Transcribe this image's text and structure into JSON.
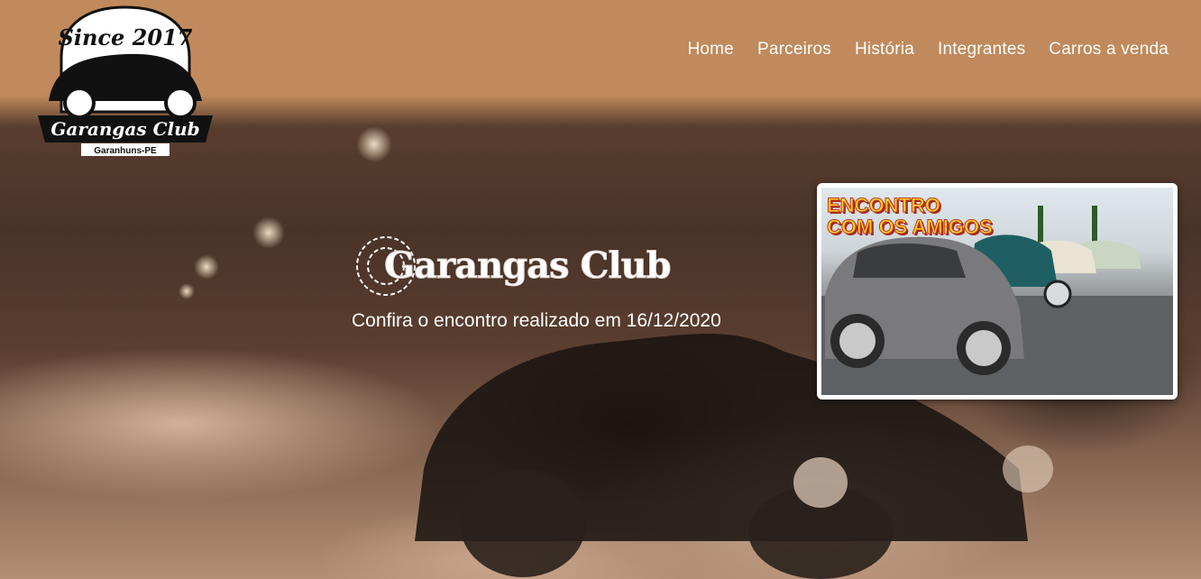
{
  "header": {
    "logo": {
      "top_text": "Since 2017",
      "banner_text": "Garangas Club",
      "bottom_text": "Garanhuns-PE"
    },
    "nav": [
      {
        "label": "Home"
      },
      {
        "label": "Parceiros"
      },
      {
        "label": "História"
      },
      {
        "label": "Integrantes"
      },
      {
        "label": "Carros a venda"
      }
    ]
  },
  "hero": {
    "brand_title": "Garangas Club",
    "subtitle": "Confira o encontro realizado em 16/12/2020"
  },
  "video": {
    "thumb_line1": "ENCONTRO",
    "thumb_line2": "COM OS AMIGOS"
  },
  "colors": {
    "header_bg": "#c18a5c",
    "thumb_text": "#ffd21e",
    "thumb_outline": "#c0392b"
  }
}
